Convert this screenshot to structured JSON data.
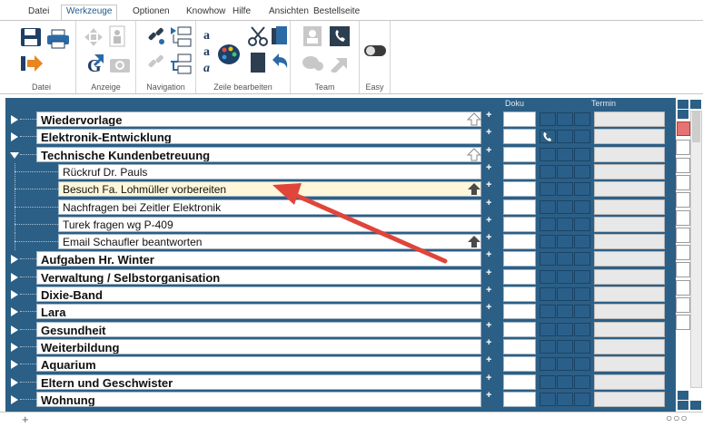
{
  "tabs": [
    "Datei",
    "Werkzeuge",
    "Optionen",
    "Knowhow",
    "Hilfe",
    "Ansichten",
    "Bestellseite"
  ],
  "active_tab": "Werkzeuge",
  "ribbon_groups": {
    "datei": "Datei",
    "anzeige": "Anzeige",
    "navigation": "Navigation",
    "zeile_bearbeiten": "Zeile bearbeiten",
    "team": "Team",
    "easy": "Easy"
  },
  "columns": {
    "doku": "Doku",
    "termin": "Termin"
  },
  "rows": [
    {
      "label": "Wiedervorlage",
      "kind": "category",
      "expanded": false,
      "highlight": false
    },
    {
      "label": "Elektronik-Entwicklung",
      "kind": "category",
      "expanded": false,
      "highlight": false
    },
    {
      "label": "Technische Kundenbetreuung",
      "kind": "category",
      "expanded": true,
      "highlight": false
    },
    {
      "label": "Rückruf Dr. Pauls",
      "kind": "task",
      "highlight": false
    },
    {
      "label": "Besuch Fa. Lohmüller vorbereiten",
      "kind": "task",
      "highlight": true
    },
    {
      "label": "Nachfragen bei Zeitler Elektronik",
      "kind": "task",
      "highlight": false
    },
    {
      "label": "Turek fragen wg P-409",
      "kind": "task",
      "highlight": false
    },
    {
      "label": "Email Schaufler beantworten",
      "kind": "task",
      "highlight": false
    },
    {
      "label": "Aufgaben Hr. Winter",
      "kind": "category",
      "expanded": false,
      "highlight": false
    },
    {
      "label": "Verwaltung / Selbstorganisation",
      "kind": "category",
      "expanded": false,
      "highlight": false
    },
    {
      "label": "Dixie-Band",
      "kind": "category",
      "expanded": false,
      "highlight": false
    },
    {
      "label": "Lara",
      "kind": "category",
      "expanded": false,
      "highlight": false
    },
    {
      "label": "Gesundheit",
      "kind": "category",
      "expanded": false,
      "highlight": false
    },
    {
      "label": "Weiterbildung",
      "kind": "category",
      "expanded": false,
      "highlight": false
    },
    {
      "label": "Aquarium",
      "kind": "category",
      "expanded": false,
      "highlight": false
    },
    {
      "label": "Eltern und Geschwister",
      "kind": "category",
      "expanded": false,
      "highlight": false
    },
    {
      "label": "Wohnung",
      "kind": "category",
      "expanded": false,
      "highlight": false
    }
  ],
  "plus_symbol": "+",
  "bottom": {
    "add": "+",
    "dots": "○○○"
  },
  "colors": {
    "panel": "#2c5f85",
    "highlight": "#fff7d9",
    "arrow": "#e0453a"
  },
  "icons": [
    "save-icon",
    "print-icon",
    "export-icon",
    "move-icon",
    "person-icon",
    "goto-icon",
    "camera-icon",
    "link-icon",
    "tree-icon",
    "text-icon",
    "palette-icon",
    "cut-icon",
    "copy-icon",
    "paste-icon",
    "undo-icon",
    "contact-icon",
    "phone-icon",
    "team-icon",
    "share-icon",
    "toggle-icon",
    "up-arrow-icon",
    "phone-small-icon"
  ]
}
